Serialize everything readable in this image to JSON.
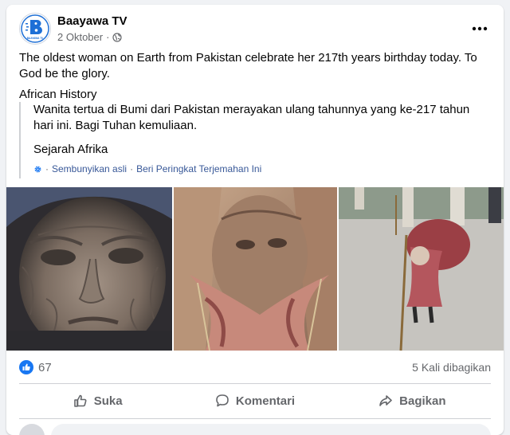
{
  "post": {
    "page_name": "Baayawa TV",
    "date": "2 Oktober",
    "separator": "·",
    "privacy_icon": "globe-icon",
    "avatar_letter": "B",
    "avatar_caption": "BAAYAWA TV",
    "text": "The oldest woman on Earth from Pakistan celebrate her 217th years birthday today. To God be the glory.",
    "subtext": "African History"
  },
  "translation": {
    "text": "Wanita tertua di Bumi dari Pakistan merayakan ulang tahunnya yang ke-217 tahun hari ini. Bagi Tuhan kemuliaan.",
    "subtext": "Sejarah Afrika",
    "hide_original": "Sembunyikan asli",
    "rate_translation": "Beri Peringkat Terjemahan Ini",
    "separator": "·",
    "settings_icon": "gear-icon"
  },
  "stats": {
    "like_count": "67",
    "share_count": "5 Kali dibagikan"
  },
  "actions": {
    "like": "Suka",
    "comment": "Komentari",
    "share": "Bagikan"
  },
  "colors": {
    "brand_blue": "#1877f2",
    "link_blue": "#385898",
    "secondary_text": "#65676b"
  }
}
